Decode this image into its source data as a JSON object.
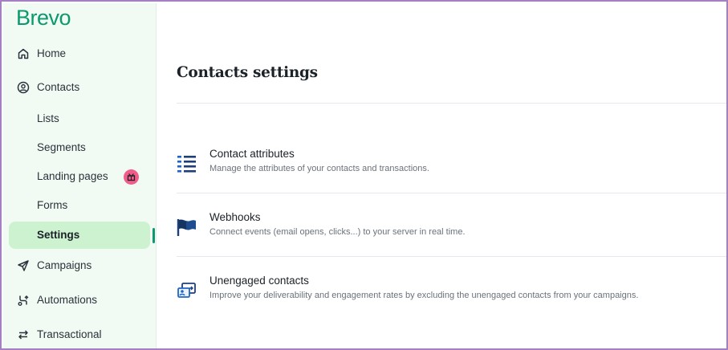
{
  "app": {
    "logo_text": "Brevo",
    "brand_color": "#0b996e",
    "border_color": "#a57fc3"
  },
  "sidebar": {
    "items": [
      {
        "label": "Home",
        "icon": "home-icon"
      },
      {
        "label": "Contacts",
        "icon": "contacts-icon"
      },
      {
        "label": "Lists"
      },
      {
        "label": "Segments"
      },
      {
        "label": "Landing pages",
        "badge_icon": "gift-icon",
        "badge_color": "#f25c8b"
      },
      {
        "label": "Forms"
      },
      {
        "label": "Settings",
        "active": true
      },
      {
        "label": "Campaigns",
        "icon": "send-icon"
      },
      {
        "label": "Automations",
        "icon": "automations-icon"
      },
      {
        "label": "Transactional",
        "icon": "transactional-icon"
      }
    ]
  },
  "main": {
    "title": "Contacts settings",
    "settings": [
      {
        "title": "Contact attributes",
        "description": "Manage the attributes of your contacts and transactions.",
        "icon": "attributes-list-icon"
      },
      {
        "title": "Webhooks",
        "description": "Connect events (email opens, clicks...) to your server in real time.",
        "icon": "webhook-flag-icon"
      },
      {
        "title": "Unengaged contacts",
        "description": "Improve your deliverability and engagement rates by excluding the unengaged contacts from your campaigns.",
        "icon": "unengaged-contacts-icon"
      }
    ]
  }
}
